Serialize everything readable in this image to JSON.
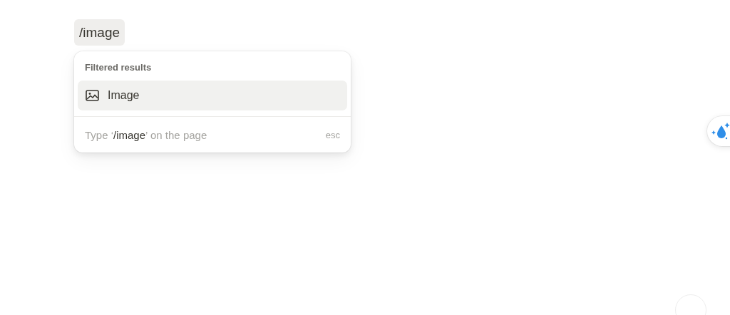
{
  "command_chip": {
    "text": "/image"
  },
  "menu": {
    "header": "Filtered results",
    "items": [
      {
        "label": "Image",
        "selected": true
      }
    ],
    "footer": {
      "hint": "Type ‘**/image**’ on the page",
      "shortcut": "esc"
    }
  },
  "floating_button": {
    "kind": "sparkle-drop"
  }
}
